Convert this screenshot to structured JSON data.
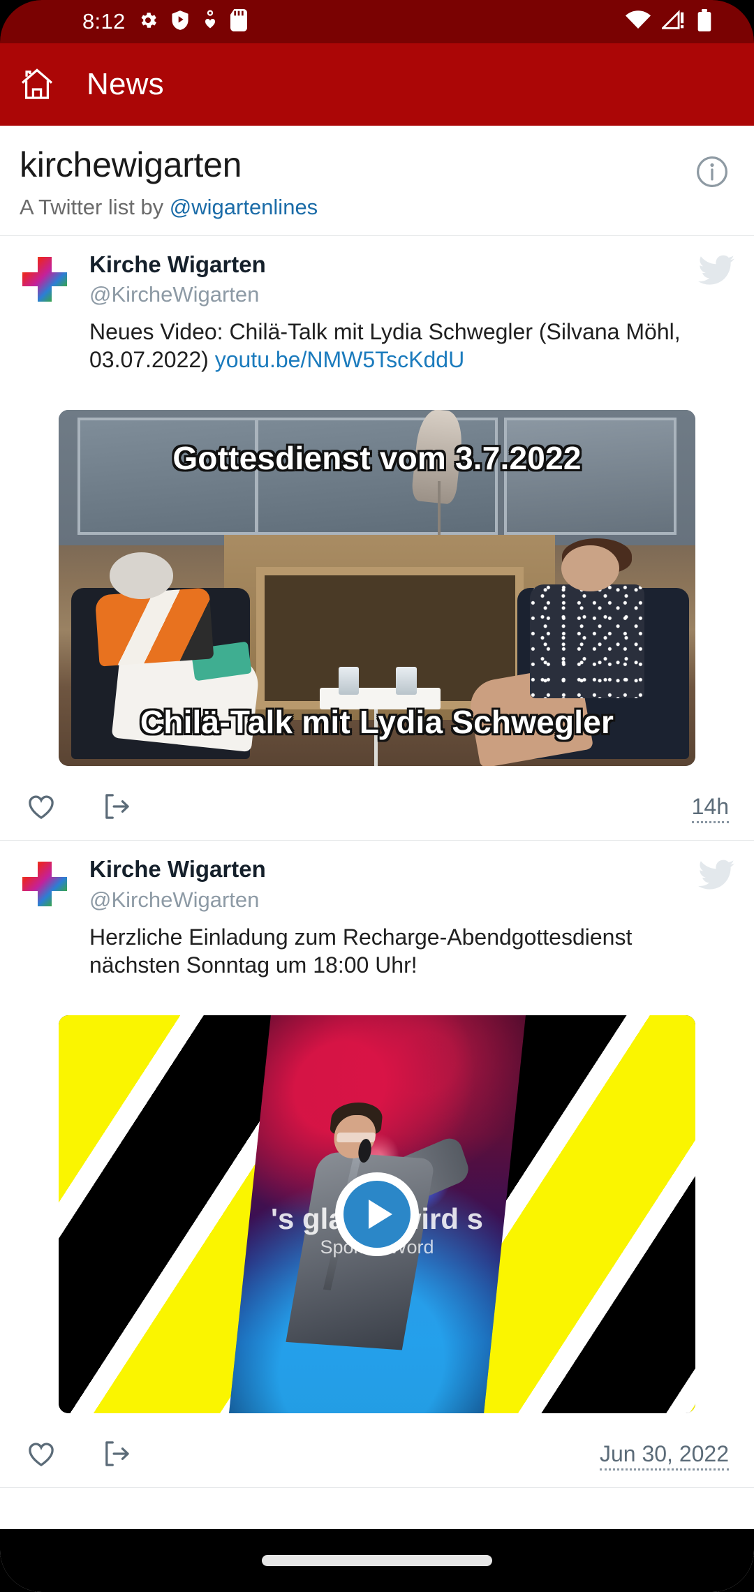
{
  "status_bar": {
    "time": "8:12",
    "icons_left": [
      "gear-icon",
      "play-protect-icon",
      "heart-pulse-icon",
      "sd-card-icon"
    ],
    "icons_right": [
      "wifi-icon",
      "cell-signal-alert-icon",
      "battery-icon"
    ],
    "background": "#7a0202"
  },
  "app_bar": {
    "home_icon": "home-icon",
    "title": "News",
    "background": "#ab0606"
  },
  "list_header": {
    "title": "kirchewigarten",
    "subtitle_prefix": "A Twitter list by ",
    "owner_handle": "@wigartenlines",
    "info_icon": "info-icon",
    "link_color": "#1b6ca8"
  },
  "tweets": [
    {
      "avatar_icon": "rainbow-cross-avatar",
      "name": "Kirche Wigarten",
      "handle": "@KircheWigarten",
      "text": "Neues Video: Chilä-Talk mit Lydia Schwegler (Silvana Möhl, 03.07.2022) ",
      "link": "youtu.be/NMW5TscKddU",
      "source_icon": "twitter-bird-icon",
      "media": {
        "kind": "image",
        "caption_top": "Gottesdienst vom 3.7.2022",
        "caption_bottom": "Chilä-Talk mit Lydia Schwegler"
      },
      "actions": {
        "like_icon": "heart-icon",
        "share_icon": "share-external-icon"
      },
      "timestamp": "14h"
    },
    {
      "avatar_icon": "rainbow-cross-avatar",
      "name": "Kirche Wigarten",
      "handle": "@KircheWigarten",
      "text": "Herzliche Einladung zum Recharge-Abendgottesdienst nächsten Sonntag um 18:00 Uhr!",
      "link": "",
      "source_icon": "twitter-bird-icon",
      "media": {
        "kind": "video",
        "overlay_title": "'s glaubt wird s",
        "overlay_subtitle": "Spoken Word",
        "play_icon": "play-icon"
      },
      "actions": {
        "like_icon": "heart-icon",
        "share_icon": "share-external-icon"
      },
      "timestamp": "Jun 30, 2022"
    }
  ],
  "nav_bar": {
    "home_indicator": "home-indicator-pill"
  }
}
